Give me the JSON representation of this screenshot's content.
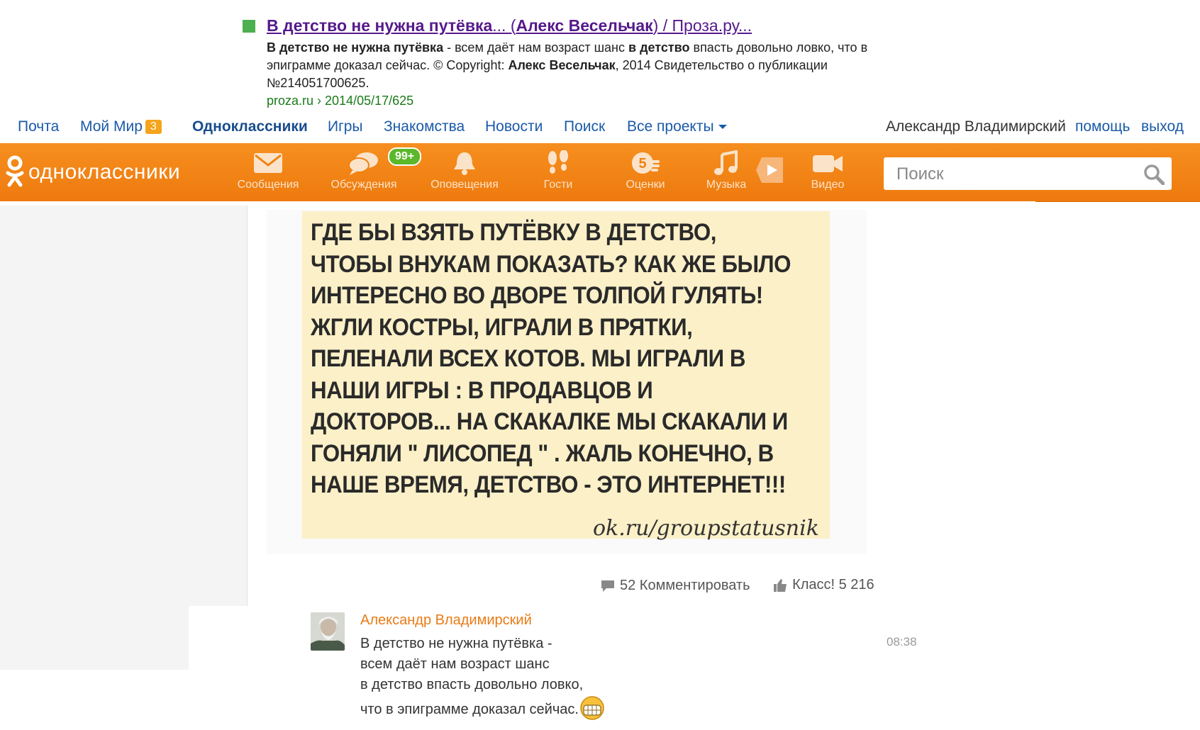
{
  "serp": {
    "title_bold1": "В детство не нужна путёвка",
    "title_mid": "... (",
    "title_bold2": "Алекс Весельчак",
    "title_end": ") / Проза.ру...",
    "snippet_bold1": "В детство не нужна путёвка",
    "snippet_t1": " - всем даёт нам возраст шанс ",
    "snippet_bold2": "в детство",
    "snippet_t2": " впасть довольно ловко, что в эпиграмме доказал сейчас. © Copyright: ",
    "snippet_bold3": "Алекс Весельчак",
    "snippet_t3": ", 2014 Свидетельство о публикации №214051700625.",
    "url": "proza.ru › 2014/05/17/625",
    "marker_color": "#4caf50"
  },
  "topbar": {
    "links": [
      "Почта",
      "Мой Мир",
      "Одноклассники",
      "Игры",
      "Знакомства",
      "Новости",
      "Поиск",
      "Все проекты"
    ],
    "moimir_badge": "3",
    "user_name": "Александр Владимирский",
    "help": "помощь",
    "logout": "выход"
  },
  "okbar": {
    "logo_text": "одноклассники",
    "brand_color": "#f28418",
    "nav": [
      {
        "label": "Сообщения",
        "icon": "envelope-icon"
      },
      {
        "label": "Обсуждения",
        "icon": "chat-bubbles-icon"
      },
      {
        "label": "Оповещения",
        "icon": "bell-icon"
      },
      {
        "label": "Гости",
        "icon": "footprints-icon"
      },
      {
        "label": "Оценки",
        "icon": "rating-5-icon"
      },
      {
        "label": "Музыка",
        "icon": "music-note-icon"
      },
      {
        "label": "Видео",
        "icon": "video-camera-icon"
      }
    ],
    "discussions_badge": "99+",
    "search_placeholder": "Поиск"
  },
  "post": {
    "image_text": "ГДЕ БЫ ВЗЯТЬ ПУТЁВКУ В ДЕТСТВО, ЧТОБЫ ВНУКАМ ПОКАЗАТЬ? КАК ЖЕ БЫЛО ИНТЕРЕСНО ВО ДВОРЕ ТОЛПОЙ ГУЛЯТЬ! ЖГЛИ КОСТРЫ, ИГРАЛИ В ПРЯТКИ, ПЕЛЕНАЛИ ВСЕХ КОТОВ. МЫ ИГРАЛИ В НАШИ ИГРЫ : В ПРОДАВЦОВ И ДОКТОРОВ... НА СКАКАЛКЕ МЫ СКАКАЛИ И ГОНЯЛИ \" ЛИСОПЕД \" . ЖАЛЬ КОНЕЧНО, В НАШЕ ВРЕМЯ, ДЕТСТВО - ЭТО ИНТЕРНЕТ!!!",
    "watermark": "ok.ru/groupstatusnik",
    "comments_label": "52 Комментировать",
    "like_label": "Класс! 5 216"
  },
  "comment": {
    "author": "Александр Владимирский",
    "lines": [
      "В детство не нужна путёвка -",
      "всем даёт нам возраст шанс",
      "в детство впасть довольно ловко,",
      "что в эпиграмме доказал сейчас."
    ],
    "time": "08:38"
  }
}
